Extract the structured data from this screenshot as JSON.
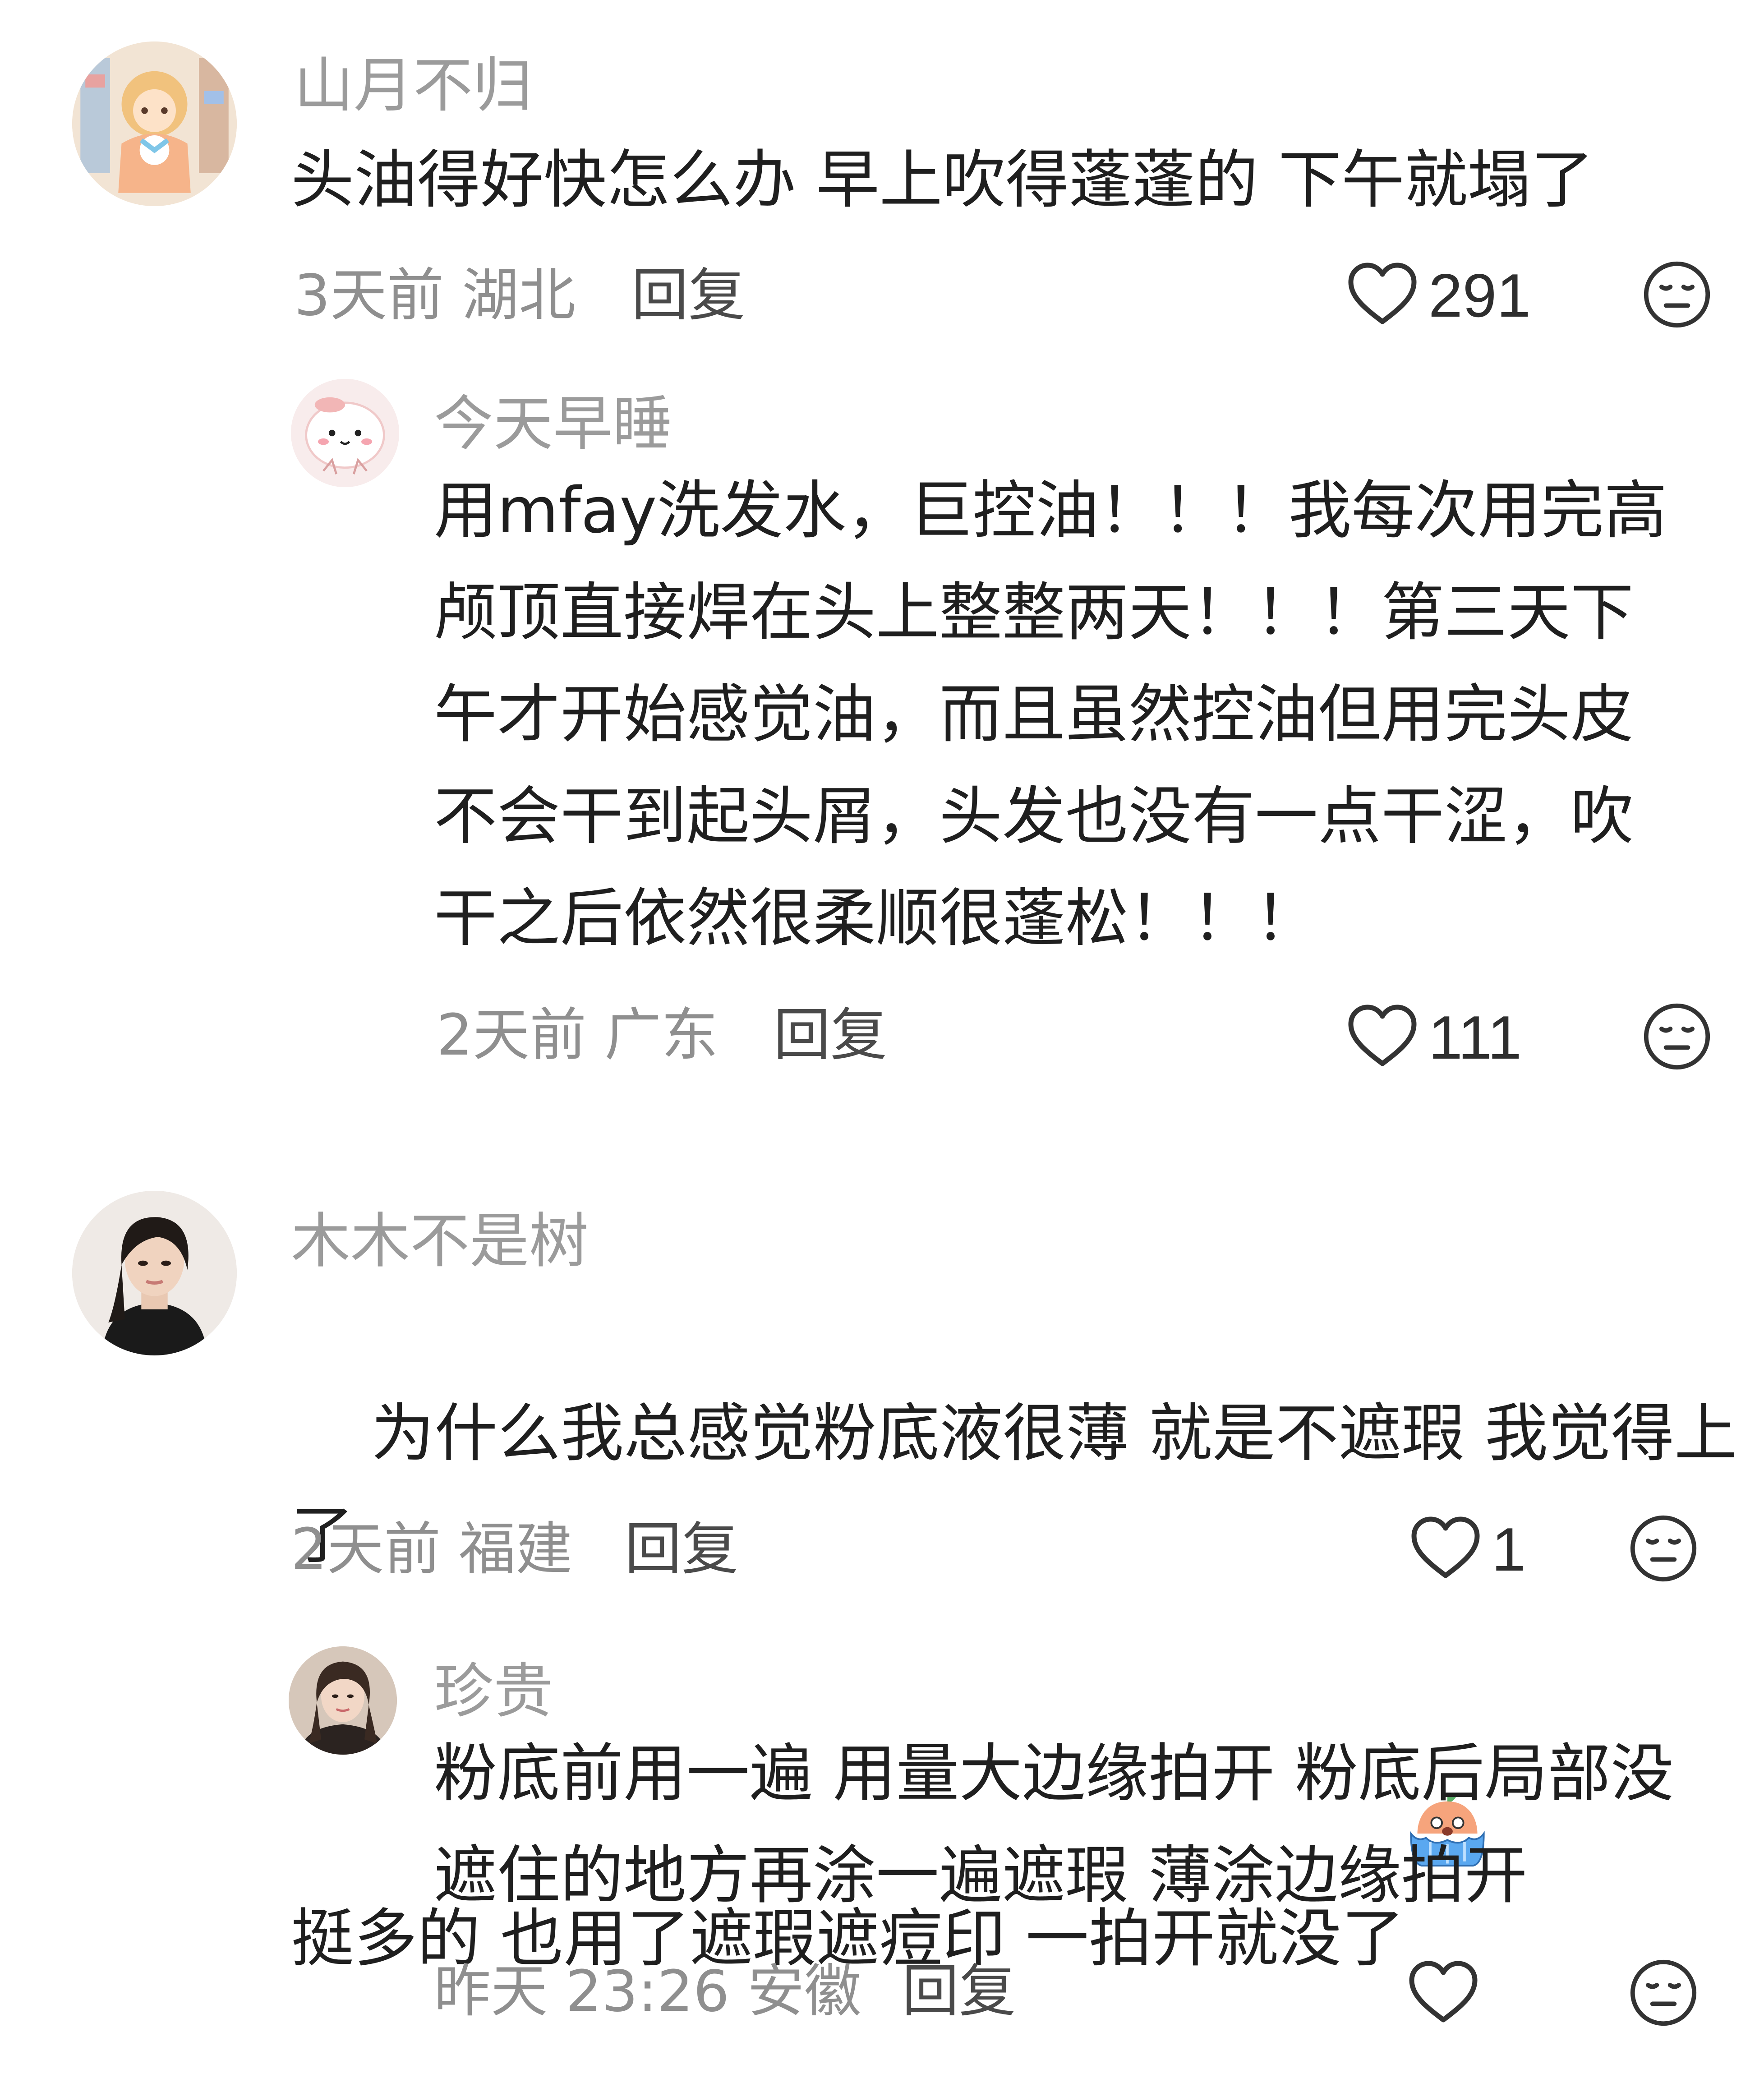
{
  "comments": [
    {
      "username": "山月不归",
      "text": "头油得好快怎么办 早上吹得蓬蓬的 下午就塌了",
      "time": "3天前",
      "location": "湖北",
      "reply_label": "回复",
      "likes": "291",
      "avatar": "anime-girl-avatar",
      "replies": [
        {
          "username": "今天早睡",
          "text": "用mfay洗发水，巨控油！！！我每次用完高\n颅顶直接焊在头上整整两天！！！第三天下\n午才开始感觉油，而且虽然控油但用完头皮\n不会干到起头屑，头发也没有一点干涩，吹\n干之后依然很柔顺很蓬松！！！",
          "time": "2天前",
          "location": "广东",
          "reply_label": "回复",
          "likes": "111",
          "avatar": "pink-blob-avatar"
        }
      ]
    },
    {
      "username": "木木不是树",
      "text": "为什么我总感觉粉底液很薄 就是不遮瑕 我觉得上了\n挺多的 也用了遮瑕遮痘印 一拍开就没了",
      "emoji": "crying-emoji",
      "time": "2天前",
      "location": "福建",
      "reply_label": "回复",
      "likes": "1",
      "avatar": "girl-photo-avatar",
      "replies": [
        {
          "username": "珍贵",
          "text": "粉底前用一遍 用量大边缘拍开 粉底后局部没\n遮住的地方再涂一遍遮瑕 薄涂边缘拍开",
          "time": "昨天 23:26",
          "location": "安徽",
          "reply_label": "回复",
          "likes": "",
          "avatar": "woman-photo-avatar"
        }
      ]
    }
  ],
  "icons": {
    "like": "heart-outline-icon",
    "dislike": "meh-face-icon"
  },
  "colors": {
    "username": "#9b9b9b",
    "body": "#1f1f1f",
    "meta": "#8f8f8f",
    "icon": "#333333"
  }
}
